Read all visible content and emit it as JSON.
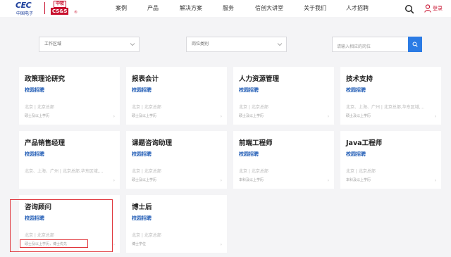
{
  "header": {
    "logo_cec_main": "CEC",
    "logo_cec_sub": "中国电子",
    "logo_css_top": "中软",
    "logo_css_bottom": "CS&S",
    "logo_css_reg": "®",
    "nav": [
      "案例",
      "产品",
      "解决方案",
      "服务",
      "信创大讲堂",
      "关于我们",
      "人才招聘"
    ],
    "login_label": "登录"
  },
  "filters": {
    "area_placeholder": "工作区域",
    "category_placeholder": "岗位类别",
    "search_placeholder": "请输入相应的岗位"
  },
  "jobs": [
    {
      "title": "政策理论研究",
      "type": "校园招聘",
      "location": "北京 | 北京总部",
      "education": "硕士及以上学历"
    },
    {
      "title": "报表会计",
      "type": "校园招聘",
      "location": "北京 | 北京总部",
      "education": "硕士及以上学历"
    },
    {
      "title": "人力资源管理",
      "type": "校园招聘",
      "location": "北京 | 北京总部",
      "education": "硕士及以上学历"
    },
    {
      "title": "技术支持",
      "type": "校园招聘",
      "location": "北京、上海、广州 | 北京总部,华东区域,...",
      "education": "硕士及以上学历"
    },
    {
      "title": "产品销售经理",
      "type": "校园招聘",
      "location": "北京、上海、广州 | 北京总部,华东区域,...",
      "education": ""
    },
    {
      "title": "课题咨询助理",
      "type": "校园招聘",
      "location": "北京 | 北京总部",
      "education": "硕士及以上学历"
    },
    {
      "title": "前端工程师",
      "type": "校园招聘",
      "location": "北京 | 北京总部",
      "education": "本科及以上学历"
    },
    {
      "title": "Java工程师",
      "type": "校园招聘",
      "location": "北京 | 北京总部",
      "education": "本科及以上学历"
    },
    {
      "title": "咨询顾问",
      "type": "校园招聘",
      "location": "北京 | 北京总部",
      "education": "硕士及以上学历，博士优先"
    },
    {
      "title": "博士后",
      "type": "校园招聘",
      "location": "北京 | 北京总部",
      "education": "博士学位"
    }
  ],
  "arrow_glyph": "›",
  "colors": {
    "brand_red": "#c8102e",
    "brand_blue": "#1d3f9b",
    "link_blue": "#1f5bb5",
    "button_blue": "#2b7be4",
    "highlight_red": "#e0363c"
  },
  "icons": {
    "search": "search-icon",
    "user": "user-icon",
    "chevron": "chevron-down-icon"
  }
}
